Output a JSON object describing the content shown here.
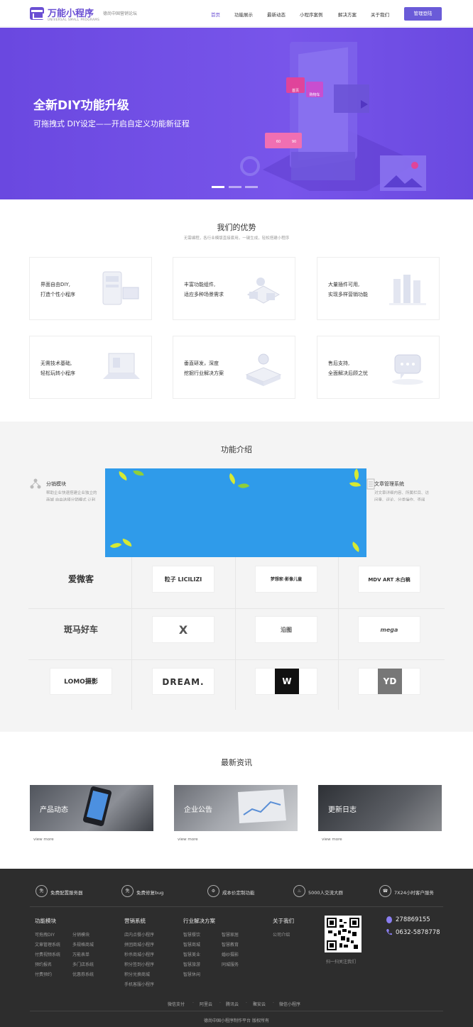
{
  "header": {
    "logo_title": "万能小程序",
    "logo_sub": "UNIVERSAL SMALL PROGRAMS",
    "slogan": "德尚中国营销论坛",
    "nav": [
      "首页",
      "功能展示",
      "最新动态",
      "小程序案例",
      "解决方案",
      "关于我们"
    ],
    "login": "管理登陆"
  },
  "hero": {
    "title": "全新DIY功能升级",
    "subtitle": "可拖拽式 DIY设定——开启自定义功能新征程",
    "tile_labels": [
      "首页",
      "购物车",
      "60",
      "90"
    ]
  },
  "advantages": {
    "title": "我们的优势",
    "subtitle": "无需编程，各行业模版直接套用，一键生成，轻松搭建小程序",
    "cards": [
      {
        "line1": "界面自由DIY,",
        "line2": "打造个性小程序"
      },
      {
        "line1": "丰富功能组件,",
        "line2": "适应多种场景需求"
      },
      {
        "line1": "大量插件可用,",
        "line2": "实现多样营销功能"
      },
      {
        "line1": "无需技术基础,",
        "line2": "轻松玩转小程序"
      },
      {
        "line1": "垂直研发，深度",
        "line2": "挖掘行业解决方案"
      },
      {
        "line1": "售后支持,",
        "line2": "全面解决后顾之忧"
      }
    ]
  },
  "features": {
    "title": "功能介绍",
    "left_title": "分销模块",
    "left_desc1": "帮助企业快速搭建企业独立的",
    "left_desc2": "商城 自由选择分销模式 让利",
    "right_title": "文章管理系统",
    "right_desc1": "对文章详细内容、所属栏目、访",
    "right_desc2": "问量、评论、分类操作、查阅"
  },
  "partners": [
    [
      "爱微客",
      "粒子 LICILIZI",
      "梦想家·影像儿童",
      "MDV ART 木白稿"
    ],
    [
      "斑马好车",
      "X",
      "沿图",
      "mega"
    ],
    [
      "LOMO摄影",
      "DREAM.",
      "W",
      "YD"
    ]
  ],
  "news": {
    "title": "最新资讯",
    "items": [
      {
        "label": "产品动态",
        "more": "view more"
      },
      {
        "label": "企业公告",
        "more": "view more"
      },
      {
        "label": "更新日志",
        "more": "view more"
      }
    ]
  },
  "footer": {
    "features": [
      {
        "icon": "免",
        "text": "免费配置服务器"
      },
      {
        "icon": "免",
        "text": "免费修复bug"
      },
      {
        "icon": "⚙",
        "text": "成本价定制功能"
      },
      {
        "icon": "♨",
        "text": "5000人交流大群"
      },
      {
        "icon": "☎",
        "text": "7X24小时客户服务"
      }
    ],
    "col1_title": "功能模块",
    "col1_a": [
      "可拖拽DIY",
      "文章管理系统",
      "付费视频系统",
      "预约报名",
      "付费预约"
    ],
    "col1_b": [
      "分销模块",
      "多规格商城",
      "万能表单",
      "多门店系统",
      "优惠券系统"
    ],
    "col2_title": "营销系统",
    "col2": [
      "店内点餐小程序",
      "拼团商城小程序",
      "秒杀商城小程序",
      "积分签到小程序",
      "积分兑换商城",
      "手机客服小程序"
    ],
    "col3_title": "行业解决方案",
    "col3_a": [
      "智慧餐饮",
      "智慧商城",
      "智慧美业",
      "智慧旅游",
      "智慧休闲"
    ],
    "col3_b": [
      "智慧家居",
      "智慧教育",
      "婚纱摄影",
      "同城服务"
    ],
    "col4_title": "关于我们",
    "col4": [
      "公司介绍"
    ],
    "qr_caption": "扫一扫关注我们",
    "qq": "278869155",
    "phone": "0632-5878778",
    "bottom_links": [
      "微信支付",
      "阿里云",
      "腾讯云",
      "聚安云",
      "微信小程序"
    ],
    "copyright": "德尚中国小程序制作平台 版权所有"
  },
  "colors": {
    "brand": "#6a4fd3",
    "hero": "#6f4ee4",
    "footer": "#2d2d2d"
  }
}
